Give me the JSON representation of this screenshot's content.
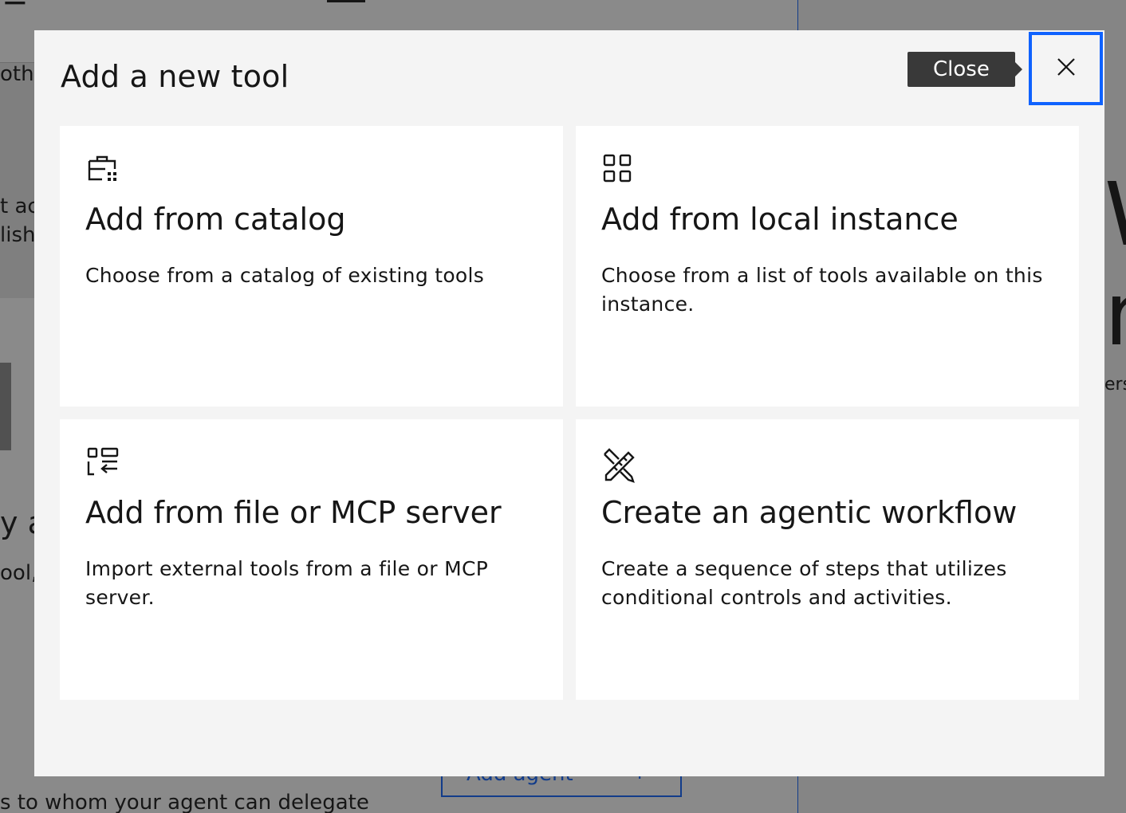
{
  "background": {
    "fragments": {
      "oth": "othe",
      "t_ac": "t ac",
      "lish": "lish",
      "y_a": "y a",
      "ool": "ool,",
      "delegate": "s to whom your agent can delegate",
      "ers": "ers",
      "big_m": "W",
      "big_n": "n"
    },
    "add_agent_label": "Add agent",
    "add_agent_plus": "+"
  },
  "modal": {
    "title": "Add a new tool",
    "close_tooltip": "Close",
    "close_icon": "close-icon",
    "tiles": [
      {
        "icon": "catalog-icon",
        "title": "Add from catalog",
        "description": "Choose from a catalog of existing tools"
      },
      {
        "icon": "apps-grid-icon",
        "title": "Add from local instance",
        "description": "Choose from a list of tools available on this instance."
      },
      {
        "icon": "import-list-icon",
        "title": "Add from file or MCP server",
        "description": "Import external tools from a file or MCP server."
      },
      {
        "icon": "tools-icon",
        "title": "Create an agentic workflow",
        "description": "Create a sequence of steps that utilizes conditional controls and activities."
      }
    ]
  },
  "colors": {
    "accent": "#0f62fe",
    "modal_bg": "#f4f4f4",
    "tile_bg": "#ffffff",
    "tooltip_bg": "#393939",
    "text": "#161616"
  }
}
